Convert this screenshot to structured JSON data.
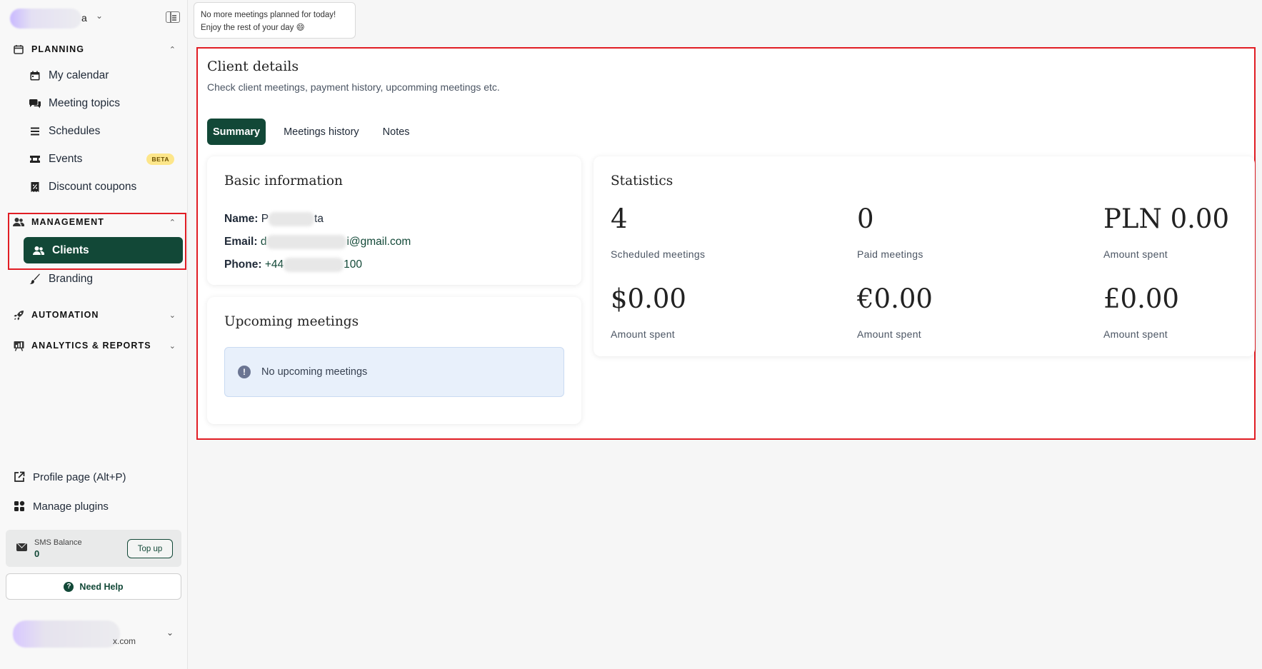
{
  "sidebar": {
    "account_name_tail": "a",
    "sections": {
      "planning": "PLANNING",
      "management": "MANAGEMENT",
      "automation": "AUTOMATION",
      "analytics": "ANALYTICS & REPORTS"
    },
    "planning_items": [
      "My calendar",
      "Meeting topics",
      "Schedules",
      "Events",
      "Discount coupons"
    ],
    "events_badge": "BETA",
    "management_items": [
      "Clients",
      "Branding"
    ],
    "profile_link": "Profile page (Alt+P)",
    "plugins_link": "Manage plugins",
    "sms_label": "SMS Balance",
    "sms_value": "0",
    "topup_label": "Top up",
    "help_label": "Need Help",
    "user_email_tail": "x.com"
  },
  "notification": {
    "line1": "No more meetings planned for today!",
    "line2": "Enjoy the rest of your day 😄"
  },
  "main": {
    "title": "Client details",
    "subtitle": "Check client meetings, payment history, upcomming meetings etc.",
    "tabs": [
      "Summary",
      "Meetings history",
      "Notes"
    ],
    "basic_info": {
      "title": "Basic information",
      "name_label": "Name:",
      "name_start": "P",
      "name_end": "ta",
      "email_label": "Email:",
      "email_start": "d",
      "email_end": "i@gmail.com",
      "phone_label": "Phone:",
      "phone_start": "+44",
      "phone_end": "100"
    },
    "upcoming": {
      "title": "Upcoming meetings",
      "empty_text": "No upcoming meetings"
    },
    "statistics": {
      "title": "Statistics",
      "items": [
        {
          "value": "4",
          "label": "Scheduled meetings"
        },
        {
          "value": "0",
          "label": "Paid meetings"
        },
        {
          "value": "PLN 0.00",
          "label": "Amount spent"
        },
        {
          "value": "$0.00",
          "label": "Amount spent"
        },
        {
          "value": "€0.00",
          "label": "Amount spent"
        },
        {
          "value": "£0.00",
          "label": "Amount spent"
        }
      ]
    }
  },
  "colors": {
    "brand_green": "#124837",
    "highlight_red": "#e11d24",
    "beta_badge": "#fde68a",
    "info_bg": "#e8f0fb"
  }
}
